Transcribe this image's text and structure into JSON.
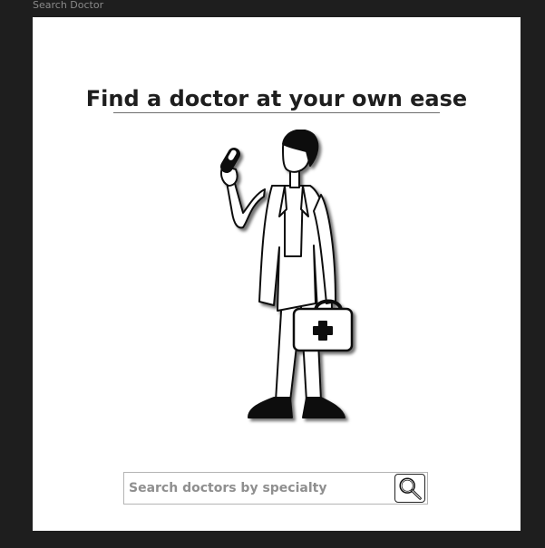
{
  "window": {
    "frame_label": "Search Doctor"
  },
  "main": {
    "heading": "Find a doctor at your own ease",
    "illustration_icon": "doctor-with-medical-kit-illustration"
  },
  "search": {
    "placeholder": "Search doctors by specialty",
    "value": "",
    "button_icon": "magnifier-icon"
  },
  "colors": {
    "background": "#1e1e1e",
    "card": "#ffffff",
    "text": "#1e1e1e",
    "placeholder": "#8f8f8f"
  }
}
